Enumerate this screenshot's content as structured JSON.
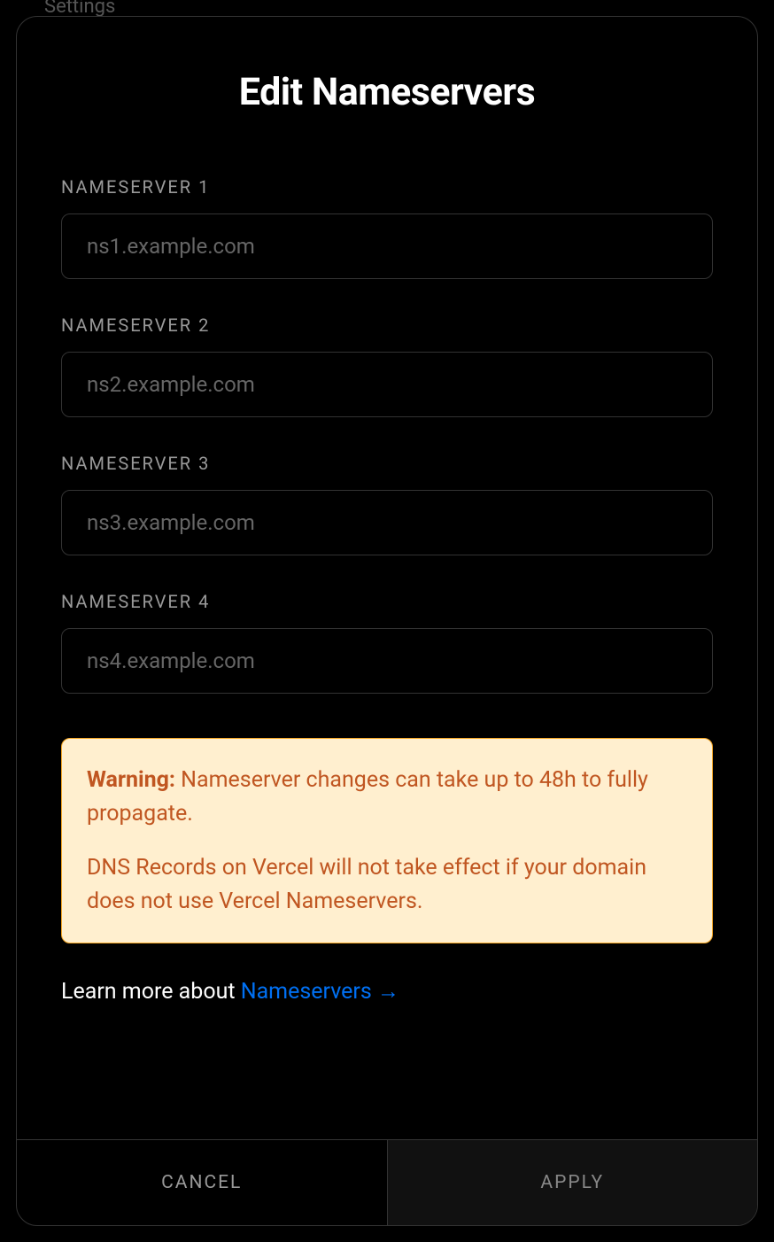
{
  "background": {
    "settings_text": "Settings"
  },
  "modal": {
    "title": "Edit Nameservers",
    "fields": [
      {
        "label": "NAMESERVER 1",
        "placeholder": "ns1.example.com",
        "value": ""
      },
      {
        "label": "NAMESERVER 2",
        "placeholder": "ns2.example.com",
        "value": ""
      },
      {
        "label": "NAMESERVER 3",
        "placeholder": "ns3.example.com",
        "value": ""
      },
      {
        "label": "NAMESERVER 4",
        "placeholder": "ns4.example.com",
        "value": ""
      }
    ],
    "warning": {
      "label": "Warning:",
      "text1": " Nameserver changes can take up to 48h to fully propagate.",
      "text2": "DNS Records on Vercel will not take effect if your domain does not use Vercel Nameservers."
    },
    "learn_more": {
      "prefix": "Learn more about ",
      "link_text": "Nameservers ",
      "arrow": "→"
    },
    "footer": {
      "cancel": "CANCEL",
      "apply": "APPLY"
    }
  }
}
